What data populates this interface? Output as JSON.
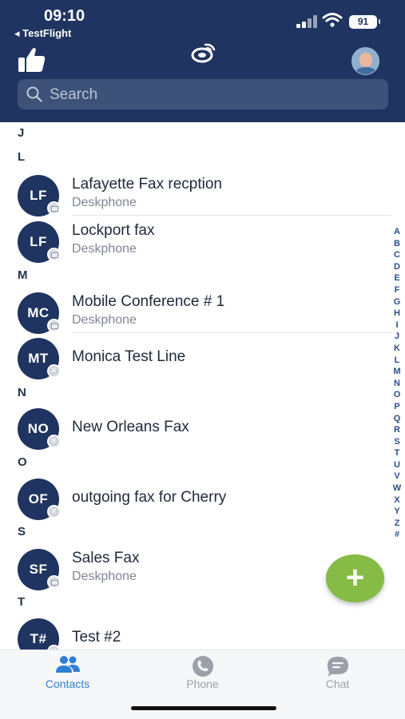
{
  "status_bar": {
    "time": "09:10",
    "back_app": "◂ TestFlight",
    "battery": "91"
  },
  "header": {
    "search_placeholder": "Search"
  },
  "sections": [
    {
      "letter": "J",
      "contacts": []
    },
    {
      "letter": "L",
      "contacts": [
        {
          "initials": "LF",
          "name": "Lafayette Fax recption",
          "subtitle": "Deskphone",
          "badge": "deskphone"
        },
        {
          "initials": "LF",
          "name": "Lockport fax",
          "subtitle": "Deskphone",
          "badge": "deskphone"
        }
      ]
    },
    {
      "letter": "M",
      "contacts": [
        {
          "initials": "MC",
          "name": "Mobile Conference # 1",
          "subtitle": "Deskphone",
          "badge": "deskphone"
        },
        {
          "initials": "MT",
          "name": "Monica Test Line",
          "subtitle": "",
          "badge": "unavailable"
        }
      ]
    },
    {
      "letter": "N",
      "contacts": [
        {
          "initials": "NO",
          "name": "New Orleans Fax",
          "subtitle": "",
          "badge": "unavailable"
        }
      ]
    },
    {
      "letter": "O",
      "contacts": [
        {
          "initials": "OF",
          "name": "outgoing fax for Cherry",
          "subtitle": "",
          "badge": "unavailable"
        }
      ]
    },
    {
      "letter": "S",
      "contacts": [
        {
          "initials": "SF",
          "name": "Sales Fax",
          "subtitle": "Deskphone",
          "badge": "deskphone"
        }
      ]
    },
    {
      "letter": "T",
      "contacts": [
        {
          "initials": "T#",
          "name": "Test #2",
          "subtitle": "",
          "badge": "unavailable"
        }
      ]
    }
  ],
  "alpha_index": [
    "A",
    "B",
    "C",
    "D",
    "E",
    "F",
    "G",
    "H",
    "I",
    "J",
    "K",
    "L",
    "M",
    "N",
    "O",
    "P",
    "Q",
    "R",
    "S",
    "T",
    "U",
    "V",
    "W",
    "X",
    "Y",
    "Z",
    "#"
  ],
  "fab": {
    "label": "+"
  },
  "tabs": [
    {
      "label": "Contacts",
      "icon": "contacts-icon",
      "active": true
    },
    {
      "label": "Phone",
      "icon": "phone-icon",
      "active": false
    },
    {
      "label": "Chat",
      "icon": "chat-icon",
      "active": false
    }
  ],
  "colors": {
    "header": "#1f3460",
    "accent": "#2f7fd6",
    "fab": "#86bb45",
    "inactive_tab": "#9aa1ab"
  }
}
